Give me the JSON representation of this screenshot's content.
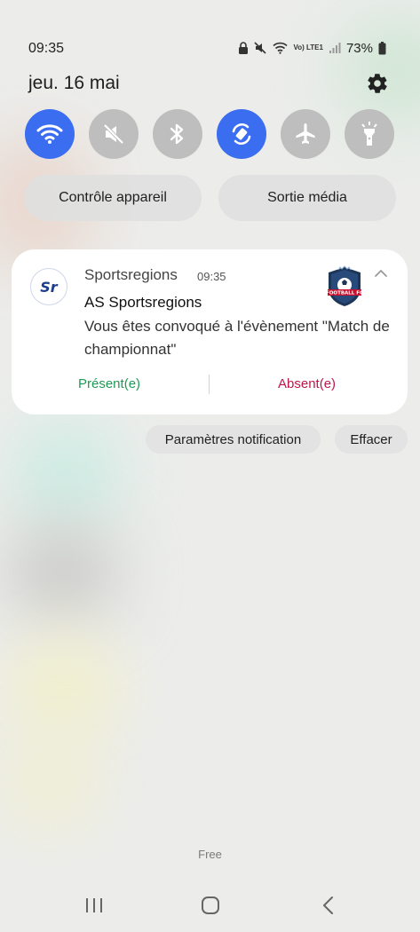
{
  "status_bar": {
    "time": "09:35",
    "network": "Vo) LTE1",
    "battery": "73%"
  },
  "panel": {
    "date": "jeu. 16 mai"
  },
  "quick_settings": [
    {
      "name": "wifi",
      "active": true
    },
    {
      "name": "mute",
      "active": false
    },
    {
      "name": "bluetooth",
      "active": false
    },
    {
      "name": "auto-rotate",
      "active": true
    },
    {
      "name": "airplane",
      "active": false
    },
    {
      "name": "flashlight",
      "active": false
    }
  ],
  "pills": {
    "device_control": "Contrôle appareil",
    "media_output": "Sortie média"
  },
  "notification": {
    "app_icon_text": "Sr",
    "app_name": "Sportsregions",
    "time": "09:35",
    "thumbnail_text": "FOOTBALL FC",
    "title": "AS Sportsregions",
    "body": "Vous êtes convoqué à l'évènement \"Match de championnat\"",
    "action_present": "Présent(e)",
    "action_absent": "Absent(e)"
  },
  "notification_buttons": {
    "settings": "Paramètres notification",
    "clear": "Effacer"
  },
  "carrier": "Free",
  "colors": {
    "accent": "#3a6df0",
    "present": "#1f9a55",
    "absent": "#c0154b"
  }
}
